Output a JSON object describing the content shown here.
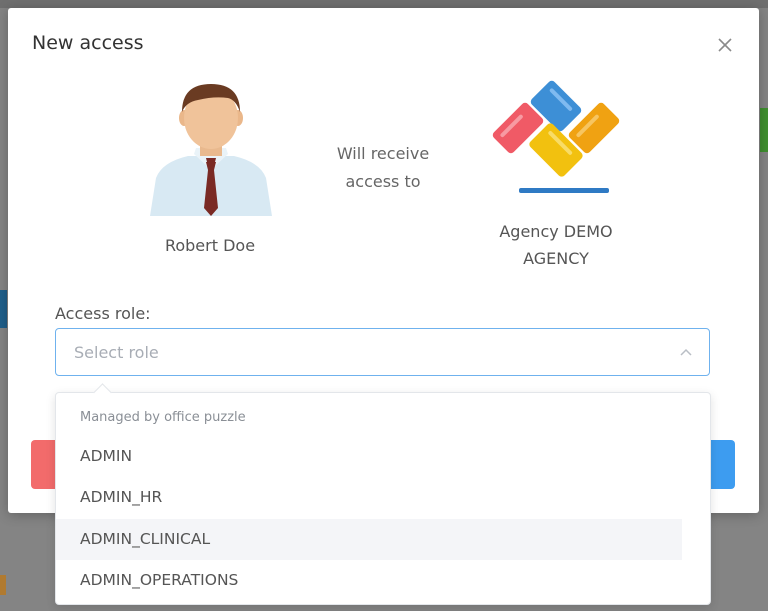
{
  "dialog": {
    "title": "New access",
    "close_icon": "close-icon"
  },
  "grantee": {
    "name": "Robert Doe",
    "avatar_icon": "person-avatar"
  },
  "connector_text": {
    "line1": "Will receive",
    "line2": "access to"
  },
  "agency": {
    "name_line1": "Agency DEMO",
    "name_line2": "AGENCY",
    "logo_icon": "agency-logo"
  },
  "role_field": {
    "label": "Access role:",
    "placeholder": "Select role",
    "state": "open"
  },
  "role_dropdown": {
    "group_label": "Managed by office puzzle",
    "options": [
      "ADMIN",
      "ADMIN_HR",
      "ADMIN_CLINICAL",
      "ADMIN_OPERATIONS"
    ],
    "highlighted": "ADMIN_CLINICAL"
  },
  "colors": {
    "accent_border": "#6fb2ee",
    "primary_button": "#3d9cf0",
    "danger_button": "#f26b6b"
  }
}
